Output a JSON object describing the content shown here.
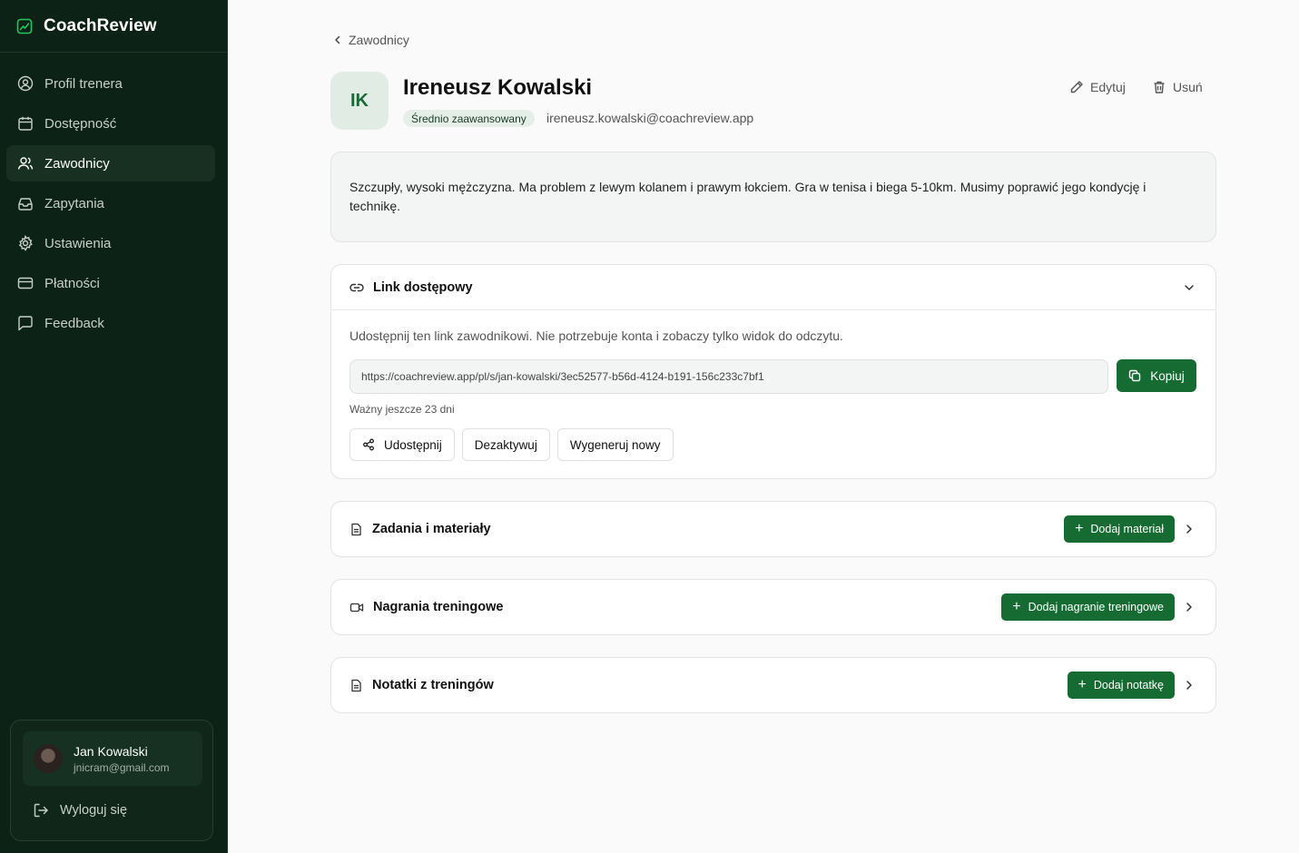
{
  "app": {
    "name": "CoachReview"
  },
  "sidebar": {
    "items": [
      {
        "label": "Profil trenera",
        "icon": "user-circle-icon",
        "active": false
      },
      {
        "label": "Dostępność",
        "icon": "calendar-icon",
        "active": false
      },
      {
        "label": "Zawodnicy",
        "icon": "users-icon",
        "active": true
      },
      {
        "label": "Zapytania",
        "icon": "inbox-icon",
        "active": false
      },
      {
        "label": "Ustawienia",
        "icon": "gear-icon",
        "active": false
      },
      {
        "label": "Płatności",
        "icon": "credit-card-icon",
        "active": false
      },
      {
        "label": "Feedback",
        "icon": "message-icon",
        "active": false
      }
    ],
    "user": {
      "name": "Jan Kowalski",
      "email": "jnicram@gmail.com"
    },
    "logout_label": "Wyloguj się"
  },
  "breadcrumb": {
    "label": "Zawodnicy"
  },
  "athlete": {
    "initials": "IK",
    "name": "Ireneusz Kowalski",
    "level": "Średnio zaawansowany",
    "email": "ireneusz.kowalski@coachreview.app",
    "description": "Szczupły, wysoki mężczyzna. Ma problem z lewym kolanem i prawym łokciem. Gra w tenisa i biega 5-10km. Musimy poprawić jego kondycję i technikę."
  },
  "actions": {
    "edit_label": "Edytuj",
    "delete_label": "Usuń"
  },
  "access_link": {
    "title": "Link dostępowy",
    "hint": "Udostępnij ten link zawodnikowi. Nie potrzebuje konta i zobaczy tylko widok do odczytu.",
    "url": "https://coachreview.app/pl/s/jan-kowalski/3ec52577-b56d-4124-b191-156c233c7bf1",
    "copy_label": "Kopiuj",
    "validity": "Ważny jeszcze 23 dni",
    "share_label": "Udostępnij",
    "deactivate_label": "Dezaktywuj",
    "regenerate_label": "Wygeneruj nowy"
  },
  "sections": [
    {
      "title": "Zadania i materiały",
      "button": "Dodaj materiał",
      "icon": "document-icon"
    },
    {
      "title": "Nagrania treningowe",
      "button": "Dodaj nagranie treningowe",
      "icon": "video-icon"
    },
    {
      "title": "Notatki z treningów",
      "button": "Dodaj notatkę",
      "icon": "document-icon"
    }
  ],
  "colors": {
    "sidebar_bg": "#0d2216",
    "accent": "#156b31",
    "badge_bg": "#e5efe7"
  }
}
